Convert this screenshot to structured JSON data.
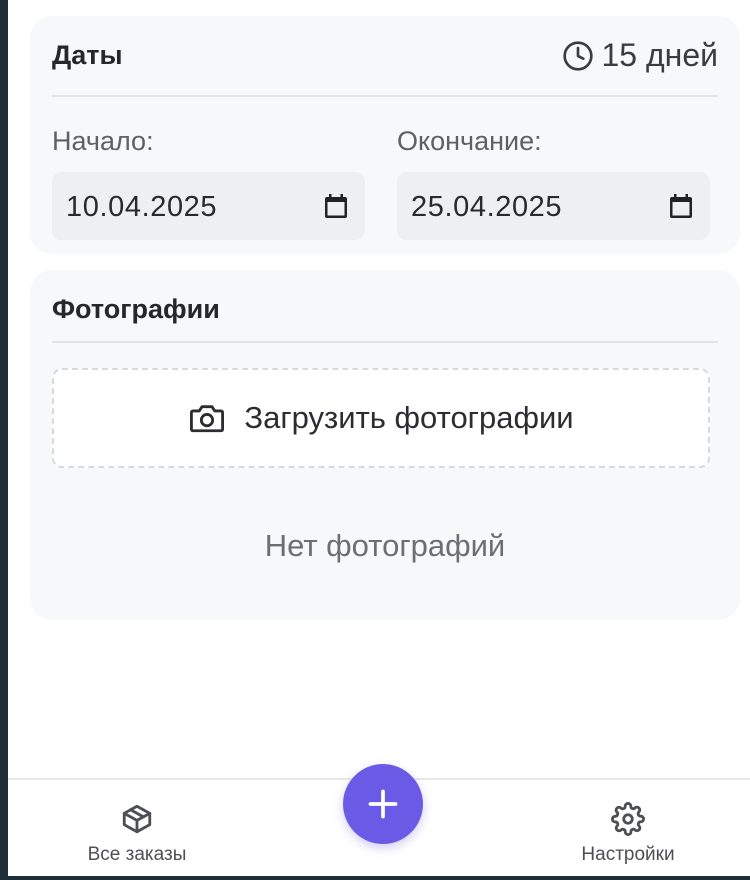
{
  "dates": {
    "title": "Даты",
    "duration": "15 дней",
    "start": {
      "label": "Начало:",
      "value": "10.04.2025"
    },
    "end": {
      "label": "Окончание:",
      "value": "25.04.2025"
    }
  },
  "photos": {
    "title": "Фотографии",
    "upload_label": "Загрузить фотографии",
    "empty_text": "Нет фотографий"
  },
  "bottom_nav": {
    "orders_label": "Все заказы",
    "settings_label": "Настройки",
    "add_icon": "plus-icon"
  },
  "colors": {
    "accent": "#6b5ae6",
    "card_bg": "#f7f8fa",
    "input_bg": "#eeeff1"
  }
}
